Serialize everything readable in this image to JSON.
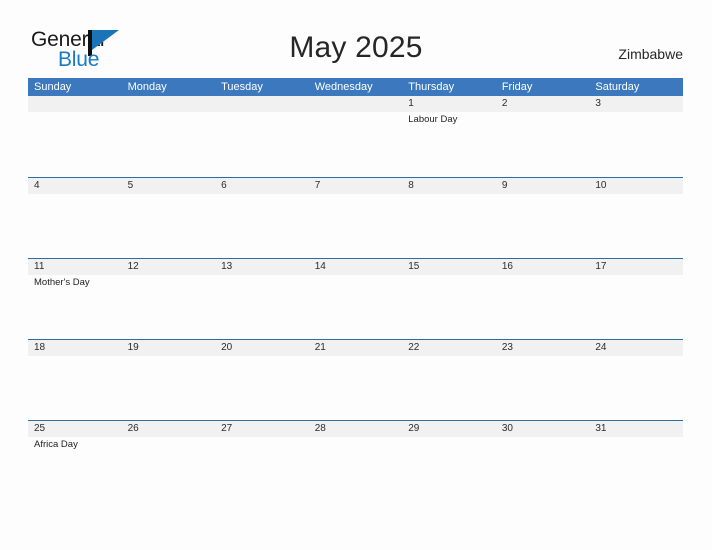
{
  "brand": {
    "name_part1": "General",
    "name_part2": "Blue",
    "flag_icon": "flag-icon",
    "accent_color": "#1B74B8"
  },
  "header": {
    "title": "May 2025",
    "country": "Zimbabwe"
  },
  "colors": {
    "header_blue": "#3B78BE",
    "row_divider_blue": "#2E6DA4",
    "date_band_gray": "#F1F1F1",
    "page_background": "#FDFDFD",
    "text_dark": "#262626",
    "logo_blue_text": "#1A7BC4"
  },
  "calendar": {
    "weekdays": [
      "Sunday",
      "Monday",
      "Tuesday",
      "Wednesday",
      "Thursday",
      "Friday",
      "Saturday"
    ],
    "weeks": [
      {
        "days": [
          {
            "num": "",
            "events": []
          },
          {
            "num": "",
            "events": []
          },
          {
            "num": "",
            "events": []
          },
          {
            "num": "",
            "events": []
          },
          {
            "num": "1",
            "events": [
              "Labour Day"
            ]
          },
          {
            "num": "2",
            "events": []
          },
          {
            "num": "3",
            "events": []
          }
        ]
      },
      {
        "days": [
          {
            "num": "4",
            "events": []
          },
          {
            "num": "5",
            "events": []
          },
          {
            "num": "6",
            "events": []
          },
          {
            "num": "7",
            "events": []
          },
          {
            "num": "8",
            "events": []
          },
          {
            "num": "9",
            "events": []
          },
          {
            "num": "10",
            "events": []
          }
        ]
      },
      {
        "days": [
          {
            "num": "11",
            "events": [
              "Mother's Day"
            ]
          },
          {
            "num": "12",
            "events": []
          },
          {
            "num": "13",
            "events": []
          },
          {
            "num": "14",
            "events": []
          },
          {
            "num": "15",
            "events": []
          },
          {
            "num": "16",
            "events": []
          },
          {
            "num": "17",
            "events": []
          }
        ]
      },
      {
        "days": [
          {
            "num": "18",
            "events": []
          },
          {
            "num": "19",
            "events": []
          },
          {
            "num": "20",
            "events": []
          },
          {
            "num": "21",
            "events": []
          },
          {
            "num": "22",
            "events": []
          },
          {
            "num": "23",
            "events": []
          },
          {
            "num": "24",
            "events": []
          }
        ]
      },
      {
        "days": [
          {
            "num": "25",
            "events": [
              "Africa Day"
            ]
          },
          {
            "num": "26",
            "events": []
          },
          {
            "num": "27",
            "events": []
          },
          {
            "num": "28",
            "events": []
          },
          {
            "num": "29",
            "events": []
          },
          {
            "num": "30",
            "events": []
          },
          {
            "num": "31",
            "events": []
          }
        ]
      }
    ]
  }
}
